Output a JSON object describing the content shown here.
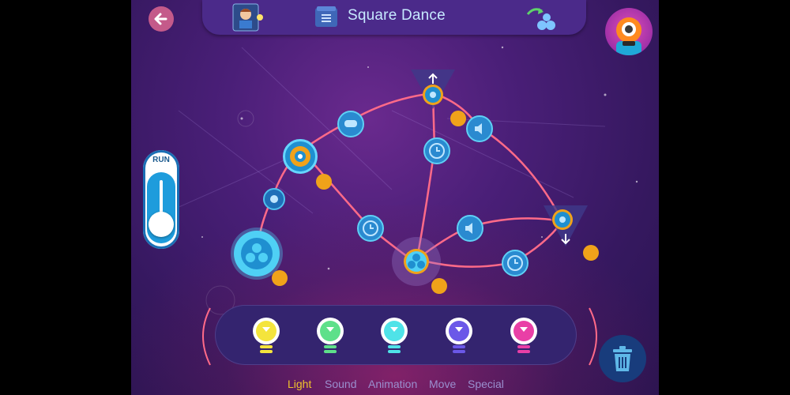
{
  "header": {
    "title": "Square Dance",
    "back_icon": "arrow-left-icon",
    "program_icon": "program-list-icon",
    "hint_icon": "teacher-hint-icon",
    "share_icon": "share-robots-icon",
    "robot_avatar_icon": "dash-robot-icon"
  },
  "run": {
    "label": "RUN"
  },
  "palette": {
    "categories": [
      {
        "label": "Light",
        "active": true
      },
      {
        "label": "Sound",
        "active": false
      },
      {
        "label": "Animation",
        "active": false
      },
      {
        "label": "Move",
        "active": false
      },
      {
        "label": "Special",
        "active": false
      }
    ],
    "bulbs": [
      {
        "name": "yellow-light-bulb",
        "color": "#f4e43c"
      },
      {
        "name": "green-light-bulb",
        "color": "#5ee08a"
      },
      {
        "name": "cyan-light-bulb",
        "color": "#4fe3e8"
      },
      {
        "name": "blue-light-bulb",
        "color": "#6b58e8"
      },
      {
        "name": "pink-light-bulb",
        "color": "#e93fa6"
      }
    ],
    "trash_icon": "trash-icon"
  },
  "colors": {
    "accent": "#1e9cdc",
    "wire": "#ff6a88",
    "connector": "#f0a21a",
    "selected_category": "#f0c32c"
  }
}
